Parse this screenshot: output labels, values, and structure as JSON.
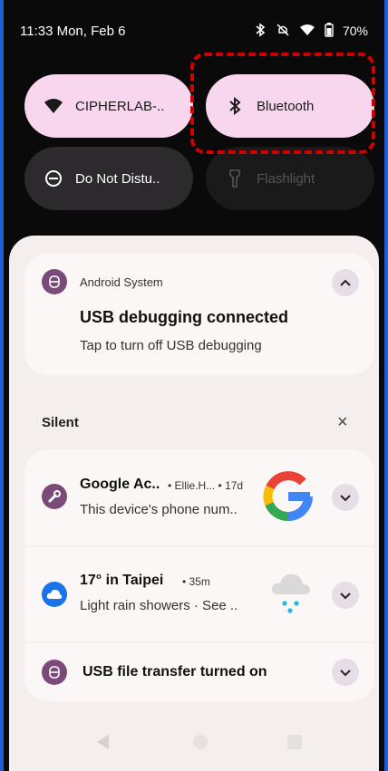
{
  "status_bar": {
    "time": "11:33 Mon, Feb 6",
    "battery": "70%"
  },
  "quick_tiles": [
    {
      "label": "CIPHERLAB-..",
      "state": "on"
    },
    {
      "label": "Bluetooth",
      "state": "on"
    },
    {
      "label": "Do Not Distu..",
      "state": "off"
    },
    {
      "label": "Flashlight",
      "state": "unavailable"
    }
  ],
  "notifications": {
    "usb_debug": {
      "app": "Android System",
      "title": "USB debugging connected",
      "body": "Tap to turn off USB debugging"
    },
    "silent_header": "Silent",
    "clear_glyph": "×",
    "google": {
      "title": "Google Ac..",
      "meta": "• Ellie.H... • 17d",
      "body": "This device's phone num.."
    },
    "weather": {
      "title": "17° in Taipei",
      "meta": "• 35m",
      "body": "Light rain showers · See .."
    },
    "usb_transfer": {
      "title": "USB file transfer turned on"
    }
  },
  "colors": {
    "accent": "#f8d7ee",
    "highlight": "#d00000",
    "app_icon": "#7a4a78"
  }
}
